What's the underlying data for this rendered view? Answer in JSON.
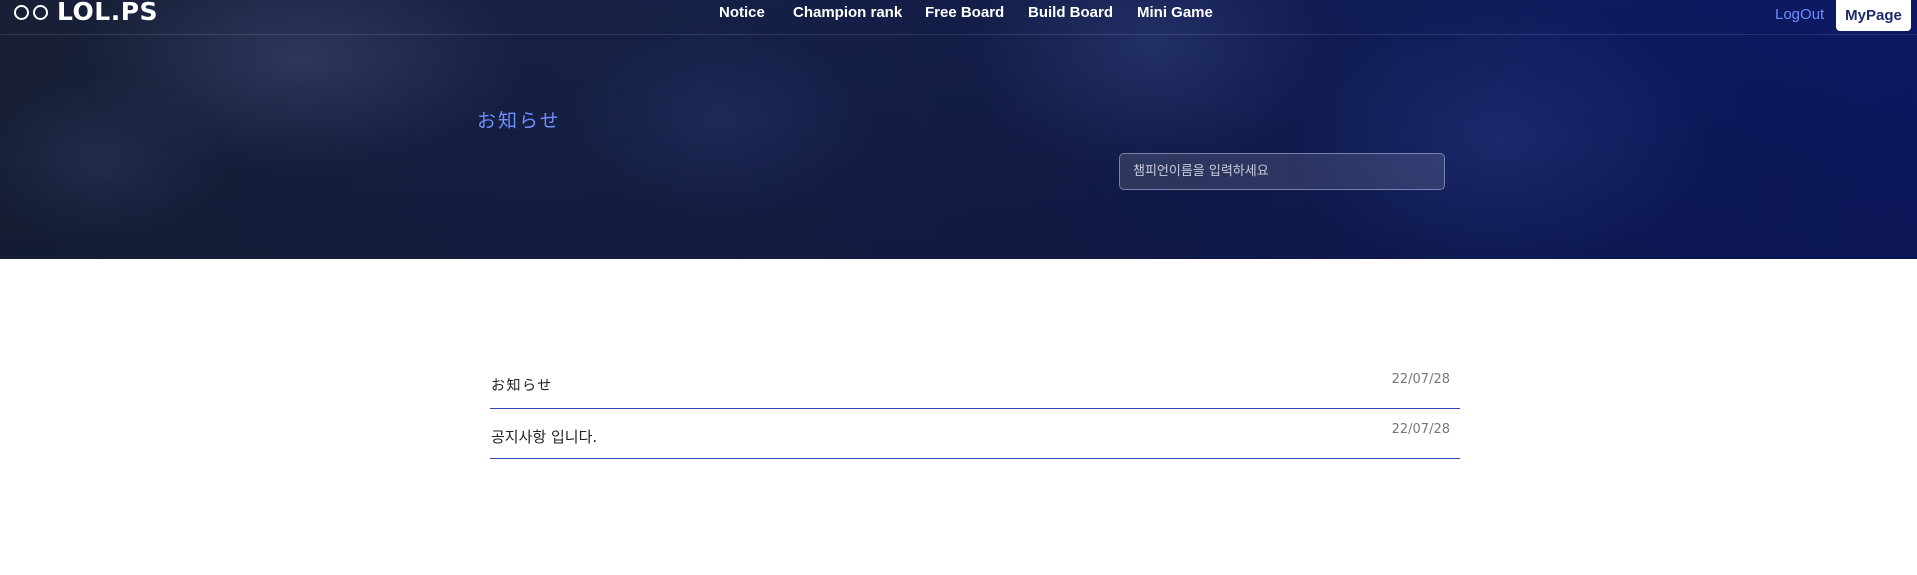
{
  "brand": {
    "name": "LOL.PS"
  },
  "nav": {
    "items": [
      "Notice",
      "Champion rank",
      "Free Board",
      "Build Board",
      "Mini Game"
    ],
    "logout_label": "LogOut",
    "mypage_label": "MyPage"
  },
  "hero": {
    "title": "お知らせ",
    "search_placeholder": "챔피언이름을 입력하세요"
  },
  "board": {
    "rows": [
      {
        "title": "お知らせ",
        "date": "22/07/28"
      },
      {
        "title": "공지사항 입니다.",
        "date": "22/07/28"
      }
    ]
  },
  "colors": {
    "accent": "#6f8eff",
    "row_border": "#2f4ab5",
    "mypage_text": "#1d2c6b"
  }
}
